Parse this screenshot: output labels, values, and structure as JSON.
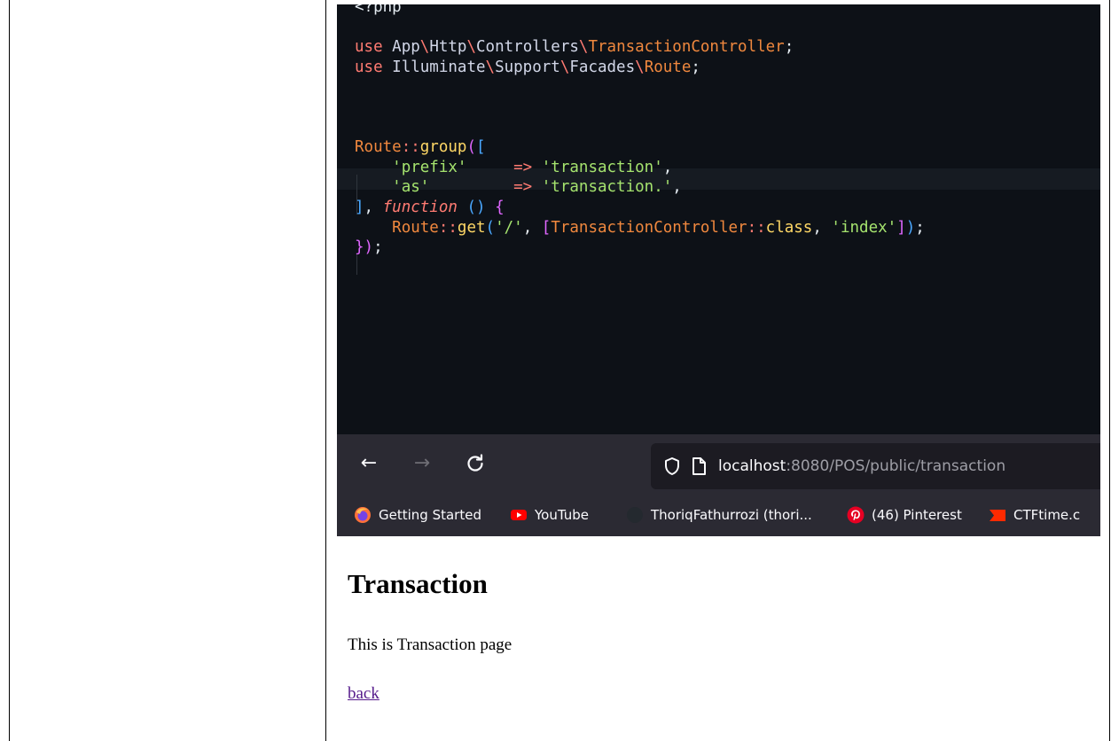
{
  "editor": {
    "lines": [
      {
        "tokens": [
          {
            "t": "<?php",
            "c": "k-pu"
          }
        ]
      },
      {
        "tokens": []
      },
      {
        "tokens": [
          {
            "t": "use ",
            "c": "k-use"
          },
          {
            "t": "App",
            "c": "k-ns"
          },
          {
            "t": "\\",
            "c": "k-sep"
          },
          {
            "t": "Http",
            "c": "k-ns"
          },
          {
            "t": "\\",
            "c": "k-sep"
          },
          {
            "t": "Controllers",
            "c": "k-ns"
          },
          {
            "t": "\\",
            "c": "k-sep"
          },
          {
            "t": "TransactionController",
            "c": "k-cls"
          },
          {
            "t": ";",
            "c": "k-pu"
          }
        ]
      },
      {
        "tokens": [
          {
            "t": "use ",
            "c": "k-use"
          },
          {
            "t": "Illuminate",
            "c": "k-ns"
          },
          {
            "t": "\\",
            "c": "k-sep"
          },
          {
            "t": "Support",
            "c": "k-ns"
          },
          {
            "t": "\\",
            "c": "k-sep"
          },
          {
            "t": "Facades",
            "c": "k-ns"
          },
          {
            "t": "\\",
            "c": "k-sep"
          },
          {
            "t": "Route",
            "c": "k-cls"
          },
          {
            "t": ";",
            "c": "k-pu"
          }
        ]
      },
      {
        "tokens": []
      },
      {
        "tokens": []
      },
      {
        "tokens": []
      },
      {
        "tokens": [
          {
            "t": "Route",
            "c": "k-call"
          },
          {
            "t": "::",
            "c": "k-op"
          },
          {
            "t": "group",
            "c": "k-fn"
          },
          {
            "t": "(",
            "c": "k-par"
          },
          {
            "t": "[",
            "c": "k-br2"
          }
        ]
      },
      {
        "tokens": [
          {
            "t": "    ",
            "c": "k-pu"
          },
          {
            "t": "'prefix'",
            "c": "k-str"
          },
          {
            "t": "     ",
            "c": "k-pu"
          },
          {
            "t": "=>",
            "c": "k-op"
          },
          {
            "t": " ",
            "c": "k-pu"
          },
          {
            "t": "'transaction'",
            "c": "k-str"
          },
          {
            "t": ",",
            "c": "k-pu"
          }
        ]
      },
      {
        "tokens": [
          {
            "t": "    ",
            "c": "k-pu"
          },
          {
            "t": "'as'",
            "c": "k-str"
          },
          {
            "t": "         ",
            "c": "k-pu"
          },
          {
            "t": "=>",
            "c": "k-op"
          },
          {
            "t": " ",
            "c": "k-pu"
          },
          {
            "t": "'transaction.'",
            "c": "k-str"
          },
          {
            "t": ",",
            "c": "k-pu"
          }
        ]
      },
      {
        "tokens": [
          {
            "t": "]",
            "c": "k-br2"
          },
          {
            "t": ", ",
            "c": "k-pu"
          },
          {
            "t": "function",
            "c": "k-kw"
          },
          {
            "t": " ",
            "c": "k-pu"
          },
          {
            "t": "()",
            "c": "k-br2"
          },
          {
            "t": " ",
            "c": "k-pu"
          },
          {
            "t": "{",
            "c": "k-par"
          }
        ]
      },
      {
        "tokens": [
          {
            "t": "    ",
            "c": "k-pu"
          },
          {
            "t": "Route",
            "c": "k-call"
          },
          {
            "t": "::",
            "c": "k-op"
          },
          {
            "t": "get",
            "c": "k-fn"
          },
          {
            "t": "(",
            "c": "k-br2"
          },
          {
            "t": "'/'",
            "c": "k-str"
          },
          {
            "t": ", ",
            "c": "k-pu"
          },
          {
            "t": "[",
            "c": "k-par"
          },
          {
            "t": "TransactionController",
            "c": "k-call"
          },
          {
            "t": "::",
            "c": "k-op"
          },
          {
            "t": "class",
            "c": "k-fn"
          },
          {
            "t": ", ",
            "c": "k-pu"
          },
          {
            "t": "'index'",
            "c": "k-str"
          },
          {
            "t": "]",
            "c": "k-par"
          },
          {
            "t": ")",
            "c": "k-br2"
          },
          {
            "t": ";",
            "c": "k-pu"
          }
        ]
      },
      {
        "tokens": [
          {
            "t": "}",
            "c": "k-par"
          },
          {
            "t": ")",
            "c": "k-par"
          },
          {
            "t": ";",
            "c": "k-pu"
          }
        ]
      }
    ]
  },
  "browser": {
    "back_icon": "arrow-left-icon",
    "forward_icon": "arrow-right-icon",
    "reload_icon": "reload-icon",
    "back_glyph": "←",
    "forward_glyph": "→",
    "reload_glyph": "C",
    "url_host": "localhost",
    "url_rest": ":8080/POS/public/transaction",
    "bookmarks": [
      {
        "label": "Getting Started",
        "icon": "firefox-icon"
      },
      {
        "label": "YouTube",
        "icon": "youtube-icon"
      },
      {
        "label": "ThoriqFathurrozi (thori...",
        "icon": "github-icon"
      },
      {
        "label": "(46) Pinterest",
        "icon": "pinterest-icon"
      },
      {
        "label": "CTFtime.c",
        "icon": "ctftime-icon"
      }
    ]
  },
  "page": {
    "heading": "Transaction",
    "body_text": "This is Transaction page",
    "back_link": "back"
  },
  "colors": {
    "editor_bg": "#0d1117",
    "chrome_bg": "#2b2a33",
    "urlbar_bg": "#1c1b22",
    "visited_link": "#551a8b"
  }
}
